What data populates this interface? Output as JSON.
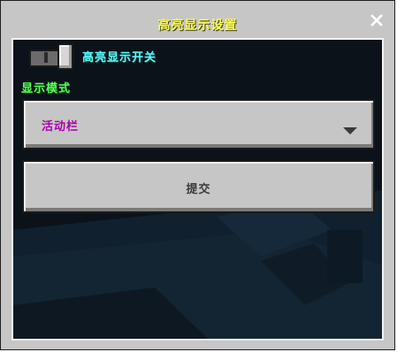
{
  "dialog": {
    "title": "高亮显示设置",
    "close_icon": "close-icon"
  },
  "toggle": {
    "label": "高亮显示开关",
    "state": "on"
  },
  "mode": {
    "label": "显示模式",
    "dropdown_value": "活动栏",
    "dropdown_icon": "chevron-down-icon"
  },
  "submit": {
    "label": "提交"
  },
  "colors": {
    "title": "#ffff55",
    "toggle_label": "#55ffff",
    "section_label": "#55ff55",
    "dropdown_value": "#aa00aa",
    "button_face": "#c6c6c6",
    "panel_background": "#0b121a"
  }
}
